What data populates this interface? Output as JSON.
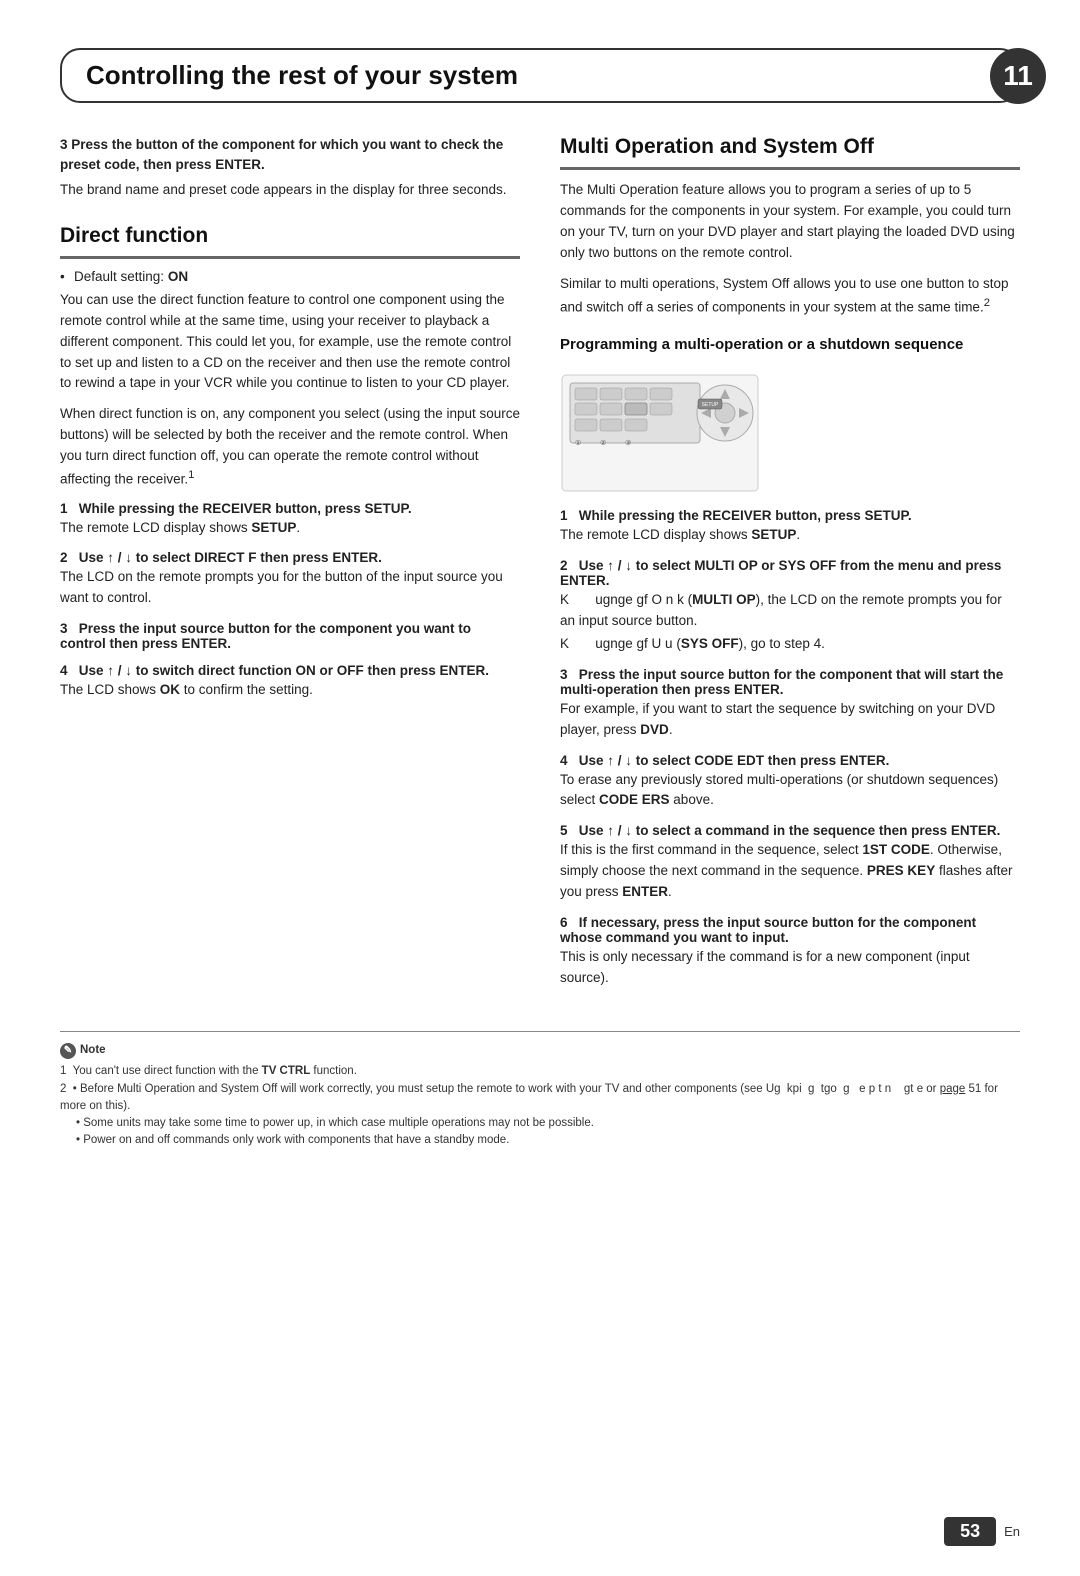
{
  "header": {
    "title": "Controlling the rest of your system",
    "chapter_number": "11"
  },
  "left_column": {
    "step3_intro": {
      "bold": "3   Press the button of the component for which you want to check the preset code, then press ENTER.",
      "body": "The brand name and preset code appears in the display for three seconds."
    },
    "direct_function": {
      "heading": "Direct function",
      "default_bullet": "Default setting: ON",
      "body1": "You can use the direct function feature to control one component using the remote control while at the same time, using your receiver to playback a different component. This could let you, for example, use the remote control to set up and listen to a CD on the receiver and then use the remote control to rewind a tape in your VCR while you continue to listen to your CD player.",
      "body2": "When direct function is on, any component you select (using the input source buttons) will be selected by both the receiver and the remote control. When you turn direct function off, you can operate the remote control without affecting the receiver.",
      "footnote_ref": "1",
      "steps": [
        {
          "number": "1",
          "bold": "While pressing the RECEIVER button, press SETUP.",
          "body": "The remote LCD display shows SETUP."
        },
        {
          "number": "2",
          "bold": "Use ↑ / ↓ to select DIRECT F then press ENTER.",
          "body": "The LCD on the remote prompts you for the button of the input source you want to control."
        },
        {
          "number": "3",
          "bold": "Press the input source button for the component you want to control then press ENTER."
        },
        {
          "number": "4",
          "bold": "Use ↑ / ↓ to switch direct function ON or OFF then press ENTER.",
          "body": "The LCD shows OK to confirm the setting."
        }
      ]
    }
  },
  "right_column": {
    "multi_operation": {
      "heading": "Multi Operation and System Off",
      "body1": "The Multi Operation feature allows you to program a series of up to 5 commands for the components in your system. For example, you could turn on your TV, turn on your DVD player and start playing the loaded DVD using only two buttons on the remote control.",
      "body2": "Similar to multi operations, System Off allows you to use one button to stop and switch off a series of components in your system at the same time.",
      "footnote_ref": "2"
    },
    "programming": {
      "sub_heading": "Programming a multi-operation or a shutdown sequence",
      "steps": [
        {
          "number": "1",
          "bold": "While pressing the RECEIVER button, press SETUP.",
          "body": "The remote LCD display shows SETUP."
        },
        {
          "number": "2",
          "bold": "Use ↑ / ↓ to select MULTI OP or SYS OFF from the menu and press ENTER.",
          "body1": "K      ugnge gf O n k (MULTI OP), the LCD on the remote prompts you for an input source button.",
          "body2": "K      ugnge gf U u (SYS OFF), go to step 4."
        },
        {
          "number": "3",
          "bold": "Press the input source button for the component that will start the multi-operation then press ENTER.",
          "body": "For example, if you want to start the sequence by switching on your DVD player, press DVD."
        },
        {
          "number": "4",
          "bold": "Use ↑ / ↓ to select CODE EDT then press ENTER.",
          "body": "To erase any previously stored multi-operations (or shutdown sequences) select CODE ERS above."
        },
        {
          "number": "5",
          "bold": "Use ↑ / ↓ to select a command in the sequence then press ENTER.",
          "body": "If this is the first command in the sequence, select 1ST CODE. Otherwise, simply choose the next command in the sequence. PRES KEY flashes after you press ENTER."
        },
        {
          "number": "6",
          "bold": "If necessary, press the input source button for the component whose command you want to input.",
          "body": "This is only necessary if the command is for a new component (input source)."
        }
      ]
    }
  },
  "notes": {
    "label": "Note",
    "items": [
      "1  You can't use direct function with the TV CTRL function.",
      "2  • Before Multi Operation and System Off will work correctly, you must setup the remote to work with your TV and other components (see Ug  kpi  g  tgo  g   e p t n    gt e or page 51 for more on this).",
      "   • Some units may take some time to power up, in which case multiple operations may not be possible.",
      "   • Power on and off commands only work with components that have a standby mode."
    ]
  },
  "page": {
    "number": "53",
    "lang": "En"
  }
}
